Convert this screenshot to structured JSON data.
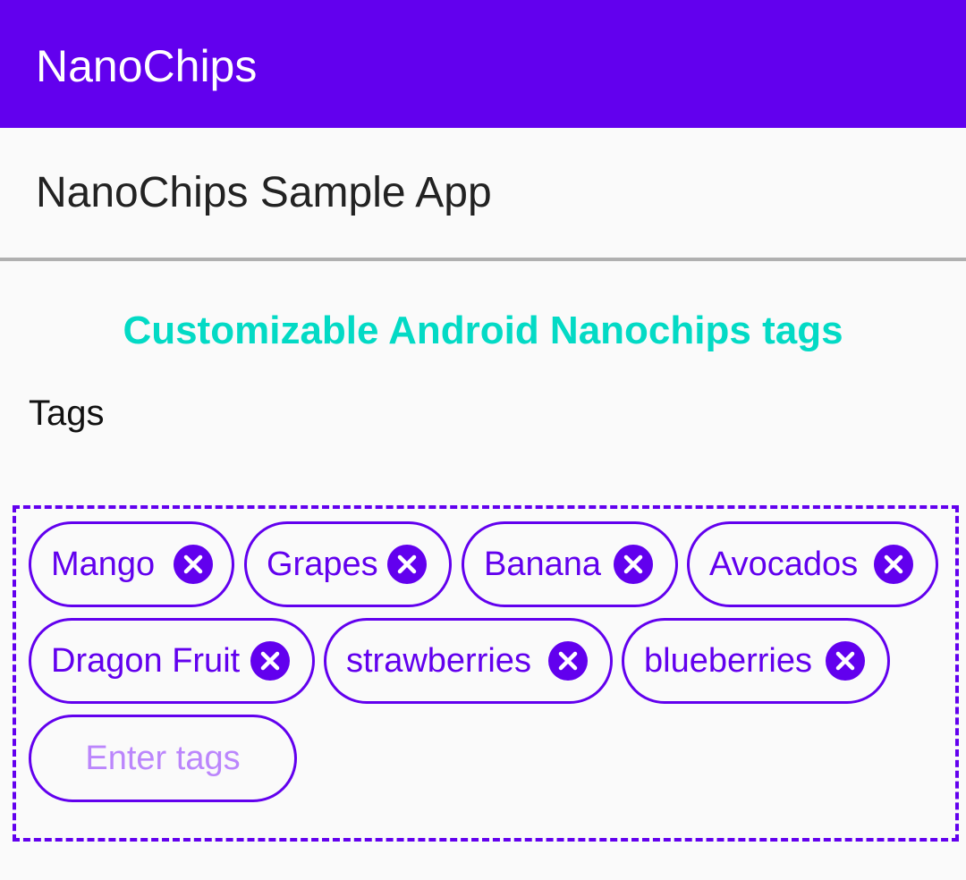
{
  "app_bar": {
    "title": "NanoChips",
    "color": "#6200ee"
  },
  "subheader": {
    "title": "NanoChips Sample App"
  },
  "heading": {
    "text": "Customizable Android Nanochips tags",
    "color": "#03dac5"
  },
  "tags_label": "Tags",
  "chips": [
    {
      "label": "Mango",
      "close_icon": "close-circle-icon"
    },
    {
      "label": "Grapes",
      "close_icon": "close-circle-icon"
    },
    {
      "label": "Banana",
      "close_icon": "close-circle-icon"
    },
    {
      "label": "Avocados",
      "close_icon": "close-circle-icon"
    },
    {
      "label": "Dragon Fruit",
      "close_icon": "close-circle-icon"
    },
    {
      "label": "strawberries",
      "close_icon": "close-circle-icon"
    },
    {
      "label": "blueberries",
      "close_icon": "close-circle-icon"
    }
  ],
  "tag_input": {
    "placeholder": "Enter tags",
    "value": ""
  },
  "colors": {
    "accent": "#6200ee",
    "placeholder": "#bb86fc"
  }
}
